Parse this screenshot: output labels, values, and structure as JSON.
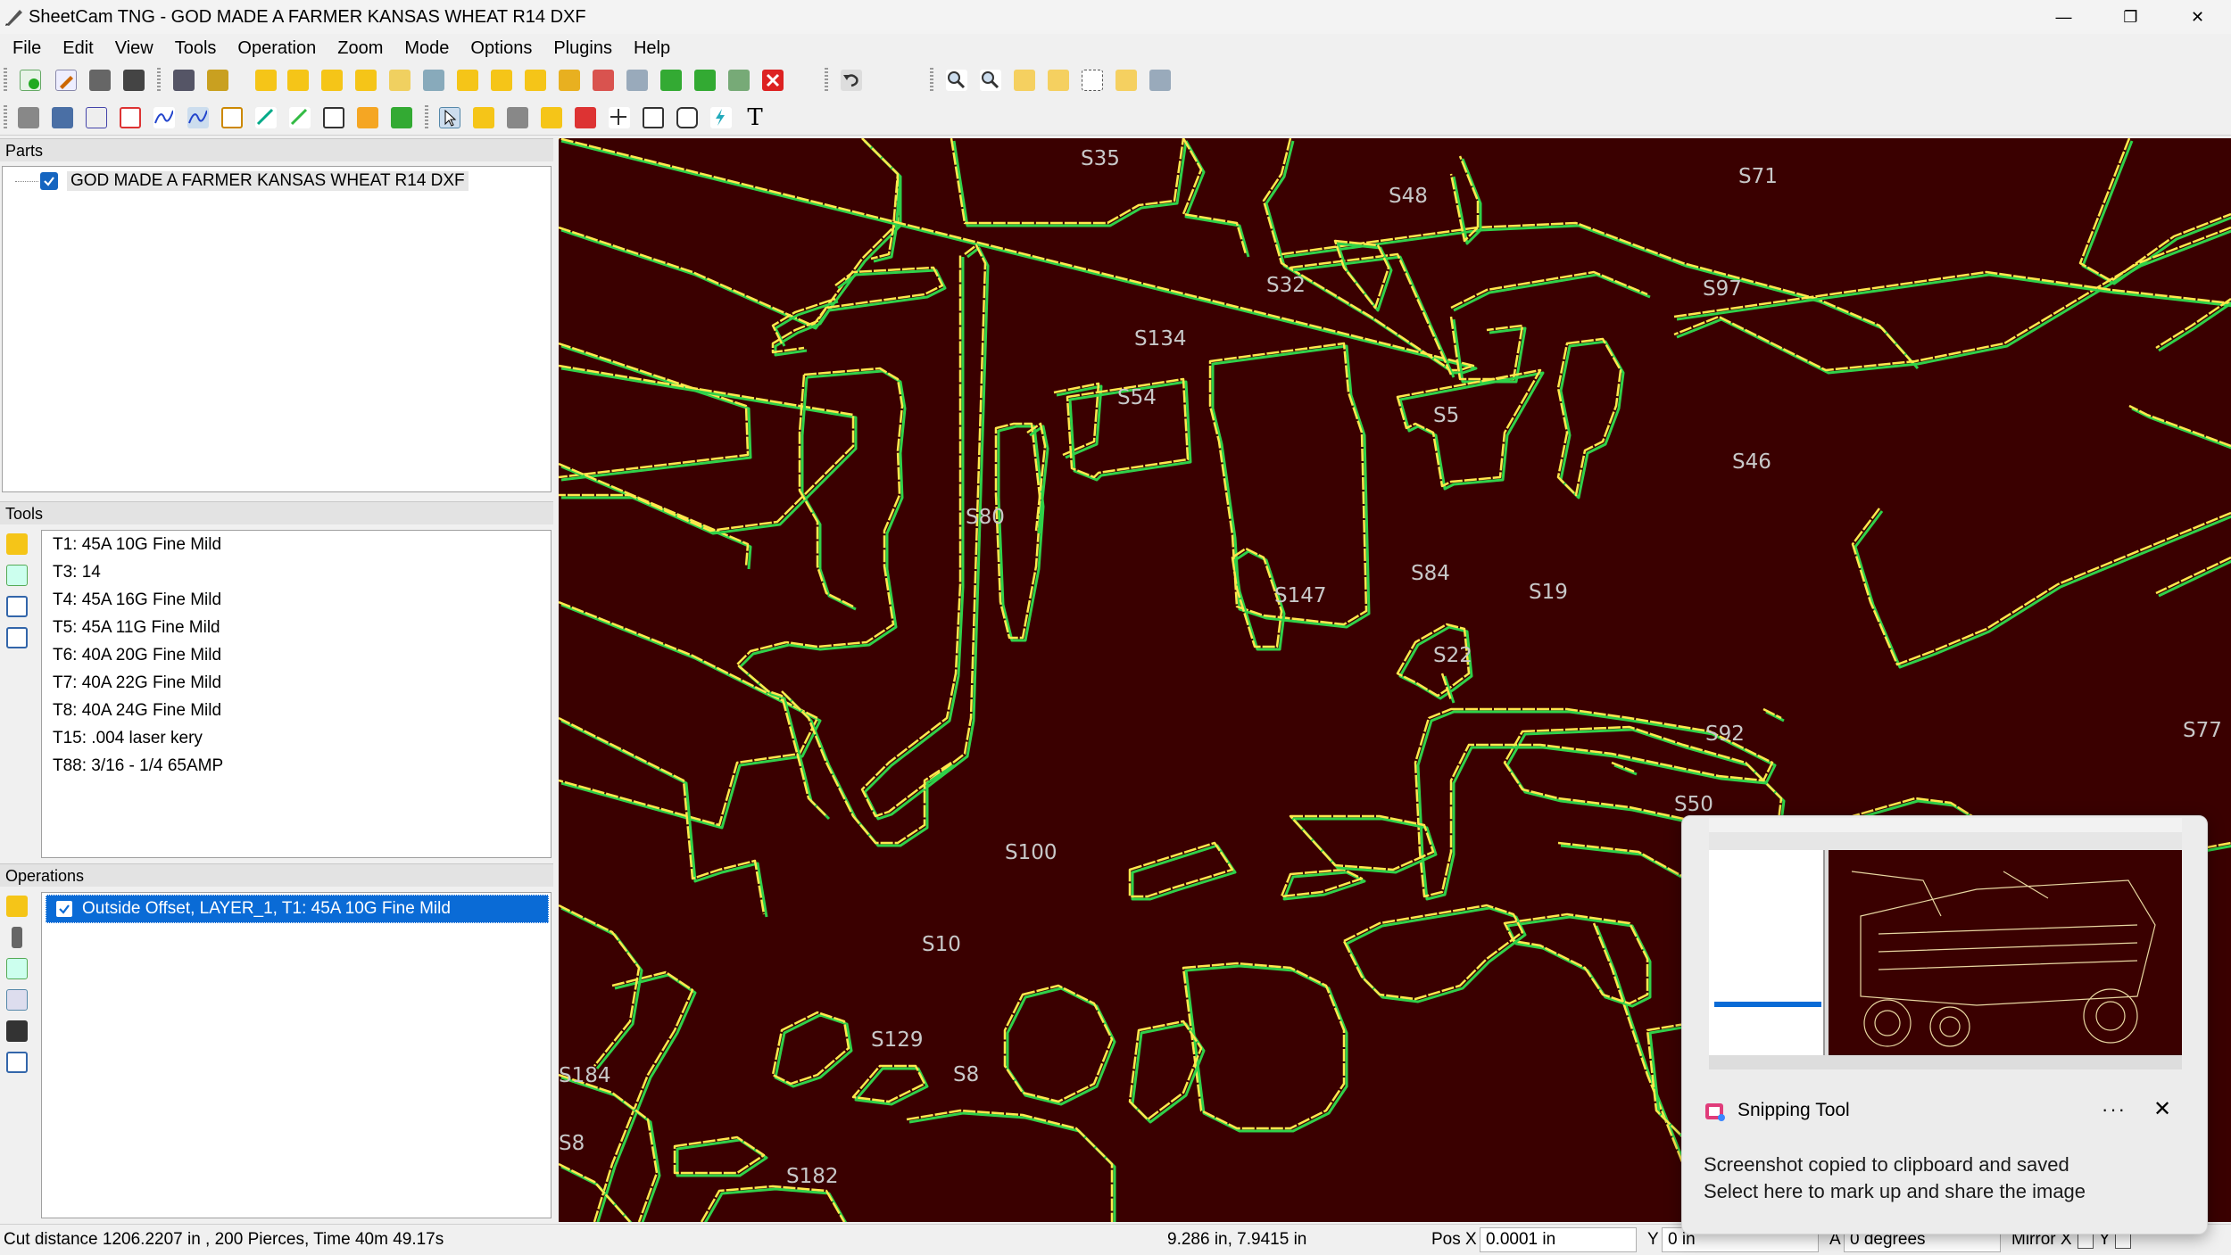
{
  "window": {
    "title": "SheetCam TNG - GOD MADE A FARMER KANSAS WHEAT R14 DXF",
    "minimize": "—",
    "restore": "❐",
    "close": "✕"
  },
  "menu": [
    "File",
    "Edit",
    "View",
    "Tools",
    "Operation",
    "Zoom",
    "Mode",
    "Options",
    "Plugins",
    "Help"
  ],
  "panels": {
    "parts": {
      "header": "Parts",
      "items": [
        "GOD MADE A FARMER KANSAS WHEAT R14 DXF"
      ]
    },
    "tools": {
      "header": "Tools",
      "items": [
        "T1: 45A 10G Fine Mild",
        "T3: 14",
        "T4: 45A 16G Fine Mild",
        "T5: 45A 11G Fine Mild",
        "T6: 40A 20G Fine Mild",
        "T7: 40A 22G Fine Mild",
        "T8: 40A 24G Fine Mild",
        "T15: .004 laser kery",
        "T88: 3/16 - 1/4 65AMP"
      ]
    },
    "operations": {
      "header": "Operations",
      "items": [
        "Outside Offset, LAYER_1, T1: 45A 10G Fine Mild"
      ]
    }
  },
  "canvas": {
    "background": "#3a0000",
    "outline_color": "#ffe84d",
    "offset_color": "#2fd14a",
    "labels": [
      "S35",
      "S48",
      "S71",
      "S32",
      "S97",
      "S134",
      "S54",
      "S5",
      "S46",
      "S80",
      "S84",
      "S147",
      "S19",
      "S22",
      "S92",
      "S77",
      "S50",
      "S100",
      "S10",
      "S129",
      "S8",
      "S184",
      "S182",
      "S8"
    ]
  },
  "status": {
    "cut_info": "Cut distance 1206.2207 in , 200 Pierces, Time 40m 49.17s",
    "coords": "9.286 in, 7.9415 in",
    "pos_x_label": "Pos X",
    "pos_x_value": "0.0001 in",
    "y_label": "Y",
    "y_value": "0 in",
    "a_label": "A",
    "a_value": "0 degrees",
    "mirror_x_label": "Mirror X",
    "mirror_y_label": "Y"
  },
  "toast": {
    "app": "Snipping Tool",
    "more": "···",
    "close": "✕",
    "line1": "Screenshot copied to clipboard and saved",
    "line2": "Select here to mark up and share the image"
  }
}
